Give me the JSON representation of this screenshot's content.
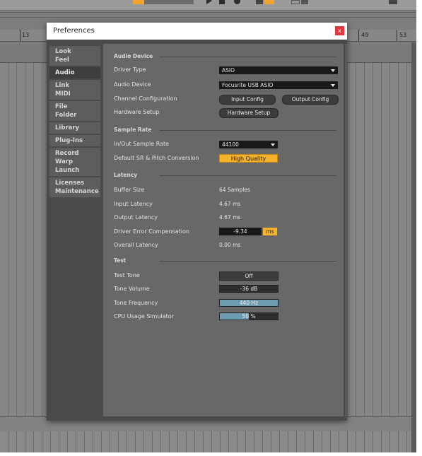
{
  "daw": {
    "ruler_marks": [
      "13",
      "49",
      "53"
    ]
  },
  "window": {
    "title": "Preferences",
    "close_glyph": "x"
  },
  "sidebar": {
    "items": [
      {
        "lines": [
          "Look",
          "Feel"
        ],
        "active": false
      },
      {
        "lines": [
          "Audio"
        ],
        "active": true
      },
      {
        "lines": [
          "Link",
          "MIDI"
        ],
        "active": false
      },
      {
        "lines": [
          "File",
          "Folder"
        ],
        "active": false
      },
      {
        "lines": [
          "Library"
        ],
        "active": false
      },
      {
        "lines": [
          "Plug-Ins"
        ],
        "active": false
      },
      {
        "lines": [
          "Record",
          "Warp",
          "Launch"
        ],
        "active": false
      },
      {
        "lines": [
          "Licenses",
          "Maintenance"
        ],
        "active": false
      }
    ]
  },
  "audio_device": {
    "header": "Audio Device",
    "driver_type_label": "Driver Type",
    "driver_type_value": "ASIO",
    "audio_device_label": "Audio Device",
    "audio_device_value": "Focusrite USB ASIO",
    "channel_config_label": "Channel Configuration",
    "input_config_button": "Input Config",
    "output_config_button": "Output Config",
    "hardware_setup_label": "Hardware Setup",
    "hardware_setup_button": "Hardware Setup"
  },
  "sample_rate": {
    "header": "Sample Rate",
    "in_out_label": "In/Out Sample Rate",
    "in_out_value": "44100",
    "default_sr_label": "Default SR & Pitch Conversion",
    "default_sr_value": "High Quality"
  },
  "latency": {
    "header": "Latency",
    "buffer_size_label": "Buffer Size",
    "buffer_size_value": "64 Samples",
    "input_latency_label": "Input Latency",
    "input_latency_value": "4.67 ms",
    "output_latency_label": "Output Latency",
    "output_latency_value": "4.67 ms",
    "driver_error_label": "Driver Error Compensation",
    "driver_error_value": "-9.34",
    "driver_error_unit": "ms",
    "overall_latency_label": "Overall Latency",
    "overall_latency_value": "0.00 ms"
  },
  "test": {
    "header": "Test",
    "test_tone_label": "Test Tone",
    "test_tone_value": "Off",
    "tone_volume_label": "Tone Volume",
    "tone_volume_value": "-36 dB",
    "tone_volume_fill": 0.0,
    "tone_frequency_label": "Tone Frequency",
    "tone_frequency_value": "440 Hz",
    "tone_frequency_fill": 1.0,
    "cpu_label": "CPU Usage Simulator",
    "cpu_value": "50 %",
    "cpu_fill": 0.5
  },
  "colors": {
    "accent": "#f6b12e",
    "slider_fill": "#6d9bb0",
    "close_button": "#e0383f"
  }
}
